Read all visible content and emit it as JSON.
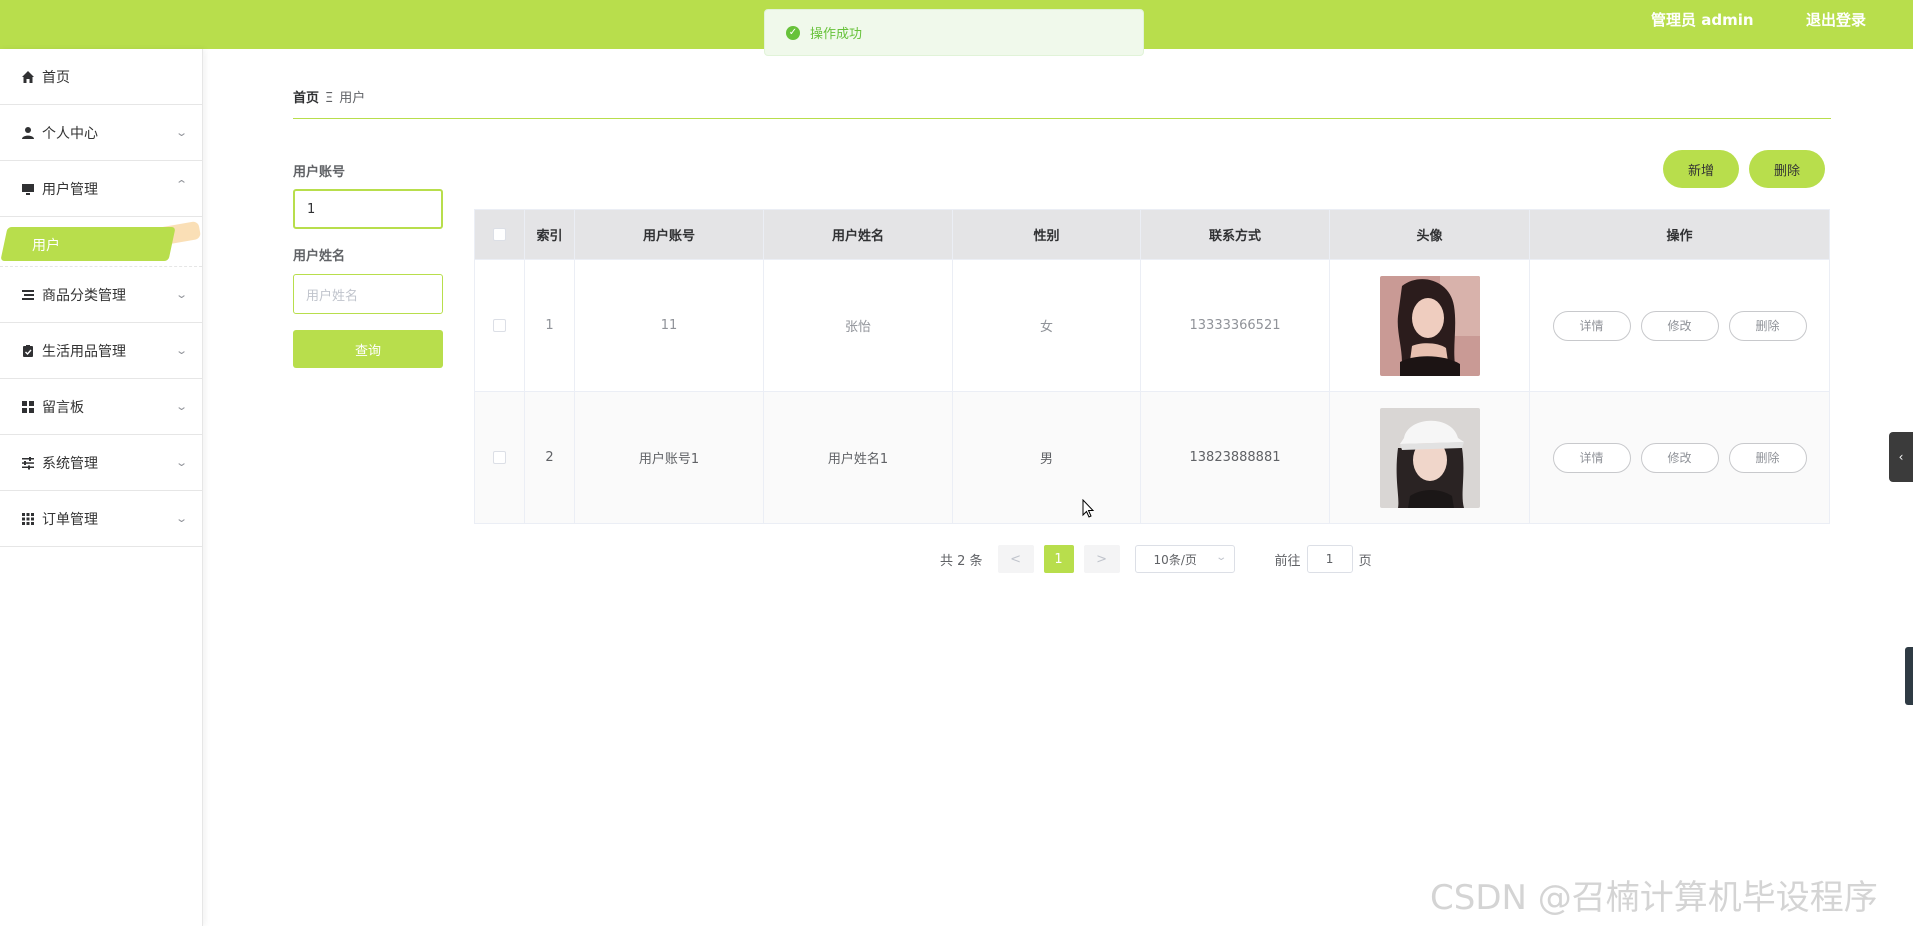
{
  "header": {
    "admin_label": "管理员 admin",
    "logout_label": "退出登录"
  },
  "toast": {
    "message": "操作成功"
  },
  "sidebar": {
    "items": [
      {
        "label": "首页",
        "icon": "home-icon"
      },
      {
        "label": "个人中心",
        "icon": "user-icon"
      },
      {
        "label": "用户管理",
        "icon": "monitor-icon",
        "expanded": true
      },
      {
        "label": "商品分类管理",
        "icon": "list-icon"
      },
      {
        "label": "生活用品管理",
        "icon": "clipboard-icon"
      },
      {
        "label": "留言板",
        "icon": "grid-icon"
      },
      {
        "label": "系统管理",
        "icon": "sliders-icon"
      },
      {
        "label": "订单管理",
        "icon": "apps-icon"
      }
    ],
    "active_sub": "用户"
  },
  "breadcrumb": {
    "home": "首页",
    "separator": "Ξ",
    "current": "用户"
  },
  "search": {
    "account_label": "用户账号",
    "account_value": "1",
    "name_label": "用户姓名",
    "name_placeholder": "用户姓名",
    "query_label": "查询"
  },
  "actions": {
    "add_label": "新增",
    "delete_label": "删除"
  },
  "table": {
    "headers": [
      "",
      "索引",
      "用户账号",
      "用户姓名",
      "性别",
      "联系方式",
      "头像",
      "操作"
    ],
    "rows": [
      {
        "index": "1",
        "account": "11",
        "name": "张怡",
        "gender": "女",
        "phone": "13333366521"
      },
      {
        "index": "2",
        "account": "用户账号1",
        "name": "用户姓名1",
        "gender": "男",
        "phone": "13823888881"
      }
    ],
    "row_actions": [
      "详情",
      "修改",
      "删除"
    ]
  },
  "pagination": {
    "total": "共 2 条",
    "prev": "<",
    "current_page": "1",
    "next": ">",
    "page_size": "10条/页",
    "goto": "前往",
    "goto_value": "1",
    "page_unit": "页"
  },
  "watermark": "CSDN @召楠计算机毕设程序",
  "colors": {
    "accent": "#b8de4c",
    "success": "#67c23a"
  }
}
